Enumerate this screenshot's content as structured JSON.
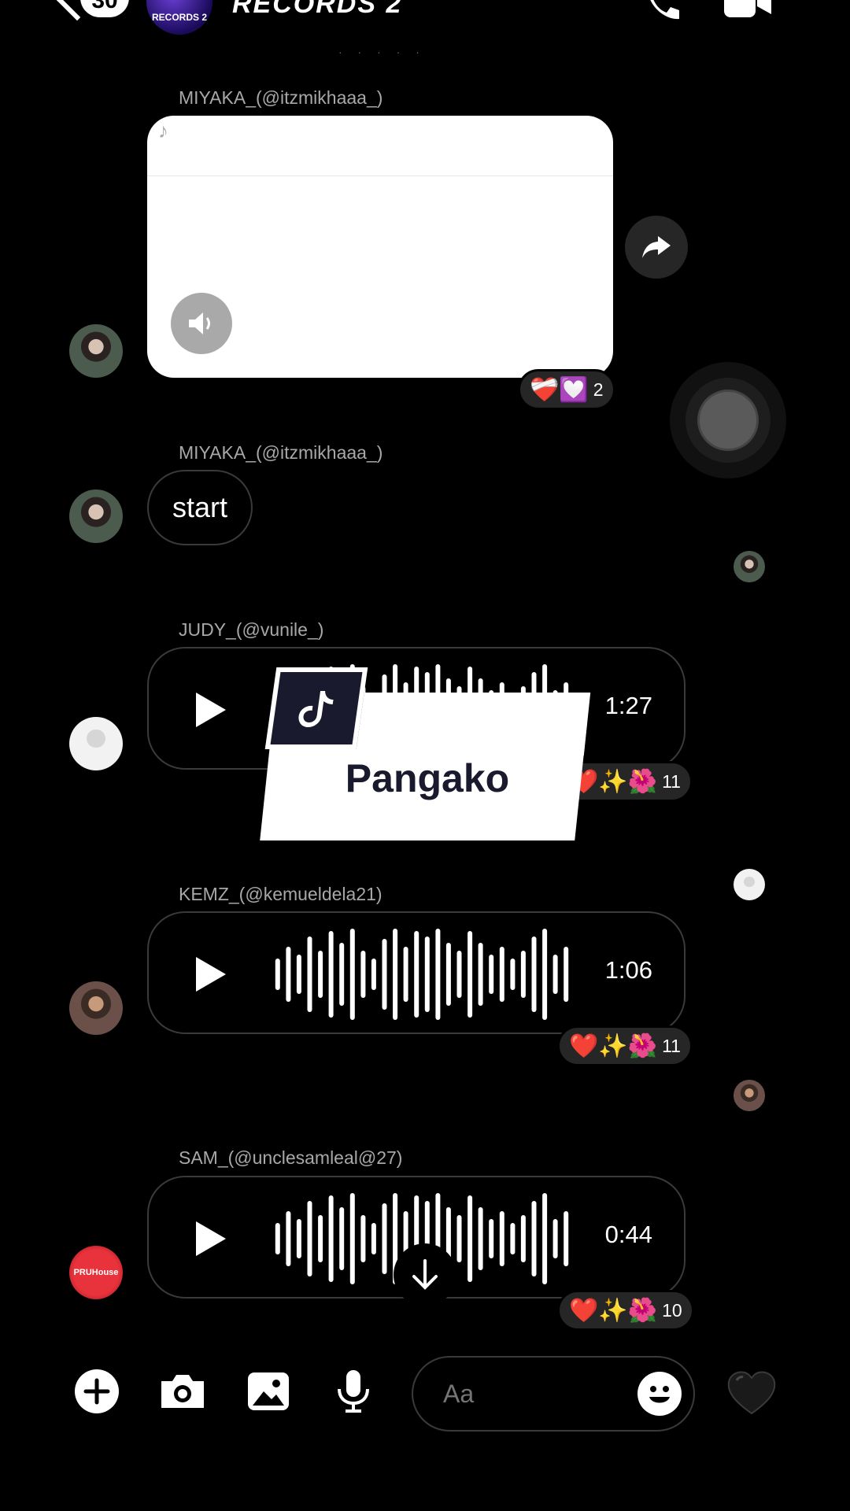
{
  "header": {
    "unread_count": "30",
    "group_avatar_text": "RECORDS 2",
    "title": "RECORDS 2",
    "icons": [
      "back-icon",
      "phone-icon",
      "video-call-icon"
    ]
  },
  "messages": [
    {
      "sender": "MIYAKA_(@itzmikhaaa_)",
      "type": "video-share",
      "reactions": {
        "emojis": "❤️‍🩹💟",
        "count": "2"
      }
    },
    {
      "sender": "MIYAKA_(@itzmikhaaa_)",
      "type": "text",
      "text": "start"
    },
    {
      "sender": "JUDY_(@vunile_)",
      "type": "voice",
      "duration": "1:27",
      "reactions": {
        "emojis": "❤️✨🌺",
        "count": "11"
      }
    },
    {
      "sender": "KEMZ_(@kemueldela21)",
      "type": "voice",
      "duration": "1:06",
      "reactions": {
        "emojis": "❤️✨🌺",
        "count": "11"
      }
    },
    {
      "sender": "SAM_(@unclesamleal@27)",
      "type": "voice",
      "duration": "0:44",
      "reactions": {
        "emojis": "❤️✨🌺",
        "count": "10"
      }
    }
  ],
  "overlay": {
    "song_title": "Pangako"
  },
  "avatars": {
    "sam_avatar_text": "PRUHouse"
  },
  "composer": {
    "placeholder": "Aa",
    "icons": [
      "add-icon",
      "camera-icon",
      "gallery-icon",
      "microphone-icon",
      "emoji-icon",
      "heart-icon"
    ]
  },
  "colors": {
    "background": "#000000",
    "bubble_border": "#3a3a3a",
    "reaction_bg": "#262626",
    "secondary_text": "#a8a8a8"
  }
}
